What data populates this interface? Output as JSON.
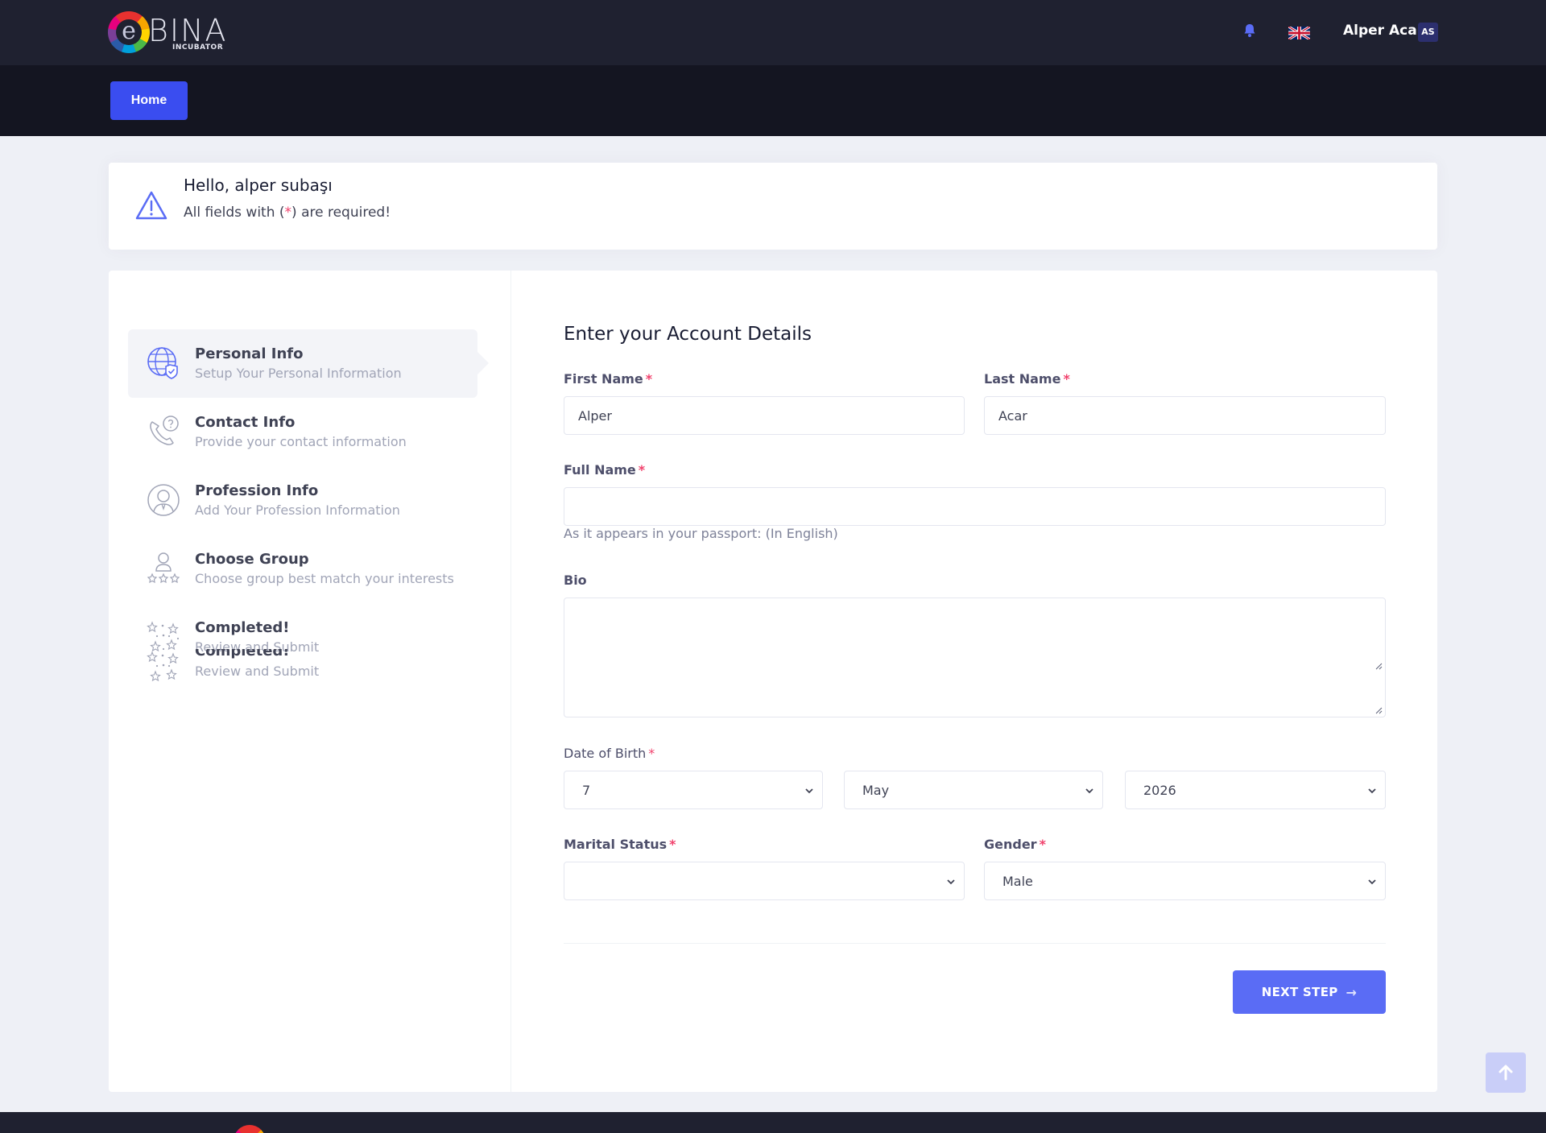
{
  "header": {
    "logo_text": "BINA",
    "logo_letter": "e",
    "logo_sub": "INCUBATOR",
    "user_name": "Alper Acar",
    "user_initials": "AS",
    "accent": "#3a4df0"
  },
  "nav": {
    "home_label": "Home"
  },
  "notice": {
    "greeting": "Hello, alper subaşı",
    "required_prefix": "All fields with (",
    "required_star": "*",
    "required_suffix": ") are required!"
  },
  "steps": [
    {
      "title": "Personal Info",
      "desc": "Setup Your Personal Information",
      "icon": "globe-shield-icon"
    },
    {
      "title": "Contact Info",
      "desc": "Provide your contact information",
      "icon": "phone-question-icon"
    },
    {
      "title": "Profession Info",
      "desc": "Add Your Profession Information",
      "icon": "person-icon"
    },
    {
      "title": "Choose Group",
      "desc": "Choose group best match your interests",
      "icon": "user-rating-icon"
    },
    {
      "title": "Completed!",
      "desc": "Review and Submit",
      "icon": "confetti-icon"
    },
    {
      "title": "Completed!",
      "desc": "Review and Submit",
      "icon": "confetti-icon"
    }
  ],
  "form": {
    "title": "Enter your Account Details",
    "first_name_label": "First Name",
    "first_name_value": "Alper",
    "last_name_label": "Last Name",
    "last_name_value": "Acar",
    "full_name_label": "Full Name",
    "full_name_value": "",
    "full_name_hint": "As it appears in your passport: (In English)",
    "bio_label": "Bio",
    "dob_label": "Date of Birth",
    "dob_day": "7",
    "dob_month": "May",
    "dob_year": "2026",
    "marital_label": "Marital Status",
    "marital_value": "",
    "gender_label": "Gender",
    "gender_value": "Male",
    "required_mark": "*",
    "next_label": "NEXT STEP",
    "next_arrow": "→"
  }
}
